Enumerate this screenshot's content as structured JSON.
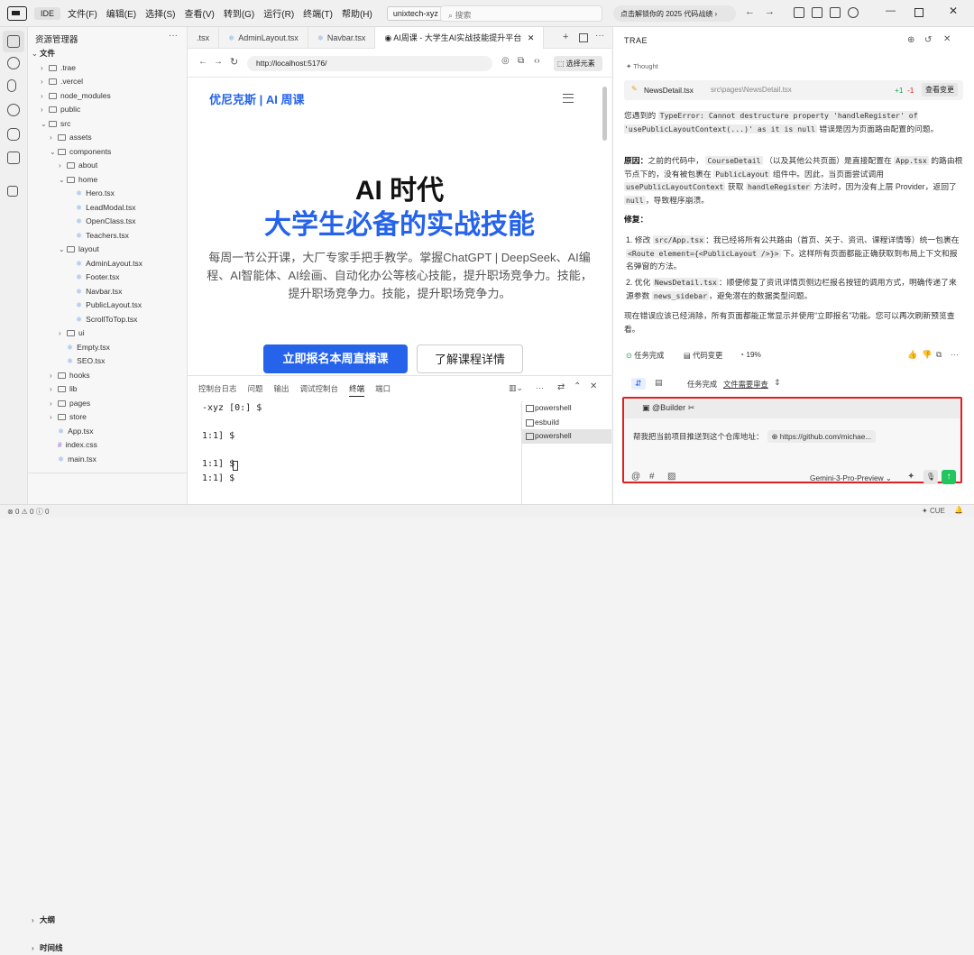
{
  "titlebar": {
    "ide": "IDE",
    "menus": [
      "文件(F)",
      "编辑(E)",
      "选择(S)",
      "查看(V)",
      "转到(G)",
      "运行(R)",
      "终端(T)",
      "帮助(H)"
    ],
    "workspace": "unixtech-xyz",
    "search_placeholder": "搜索",
    "promo": "点击解锁你的 2025 代码战绩"
  },
  "explorer": {
    "title": "资源管理器",
    "section": "文件",
    "outline": "大纲",
    "timeline": "时间线",
    "tree": [
      {
        "depth": 1,
        "kind": "dir",
        "open": false,
        "label": ".trae"
      },
      {
        "depth": 1,
        "kind": "dir",
        "open": false,
        "label": ".vercel"
      },
      {
        "depth": 1,
        "kind": "dir",
        "open": false,
        "label": "node_modules"
      },
      {
        "depth": 1,
        "kind": "dir",
        "open": false,
        "label": "public"
      },
      {
        "depth": 1,
        "kind": "dir",
        "open": true,
        "label": "src"
      },
      {
        "depth": 2,
        "kind": "dir",
        "open": false,
        "label": "assets"
      },
      {
        "depth": 2,
        "kind": "dir",
        "open": true,
        "label": "components"
      },
      {
        "depth": 3,
        "kind": "dir",
        "open": false,
        "label": "about"
      },
      {
        "depth": 3,
        "kind": "dir",
        "open": true,
        "label": "home"
      },
      {
        "depth": 4,
        "kind": "tsx",
        "label": "Hero.tsx"
      },
      {
        "depth": 4,
        "kind": "tsx",
        "label": "LeadModal.tsx"
      },
      {
        "depth": 4,
        "kind": "tsx",
        "label": "OpenClass.tsx"
      },
      {
        "depth": 4,
        "kind": "tsx",
        "label": "Teachers.tsx"
      },
      {
        "depth": 3,
        "kind": "dir",
        "open": true,
        "label": "layout"
      },
      {
        "depth": 4,
        "kind": "tsx",
        "label": "AdminLayout.tsx"
      },
      {
        "depth": 4,
        "kind": "tsx",
        "label": "Footer.tsx"
      },
      {
        "depth": 4,
        "kind": "tsx",
        "label": "Navbar.tsx"
      },
      {
        "depth": 4,
        "kind": "tsx",
        "label": "PublicLayout.tsx"
      },
      {
        "depth": 4,
        "kind": "tsx",
        "label": "ScrollToTop.tsx"
      },
      {
        "depth": 3,
        "kind": "dir",
        "open": false,
        "label": "ui"
      },
      {
        "depth": 3,
        "kind": "tsx",
        "label": "Empty.tsx"
      },
      {
        "depth": 3,
        "kind": "tsx",
        "label": "SEO.tsx"
      },
      {
        "depth": 2,
        "kind": "dir",
        "open": false,
        "label": "hooks"
      },
      {
        "depth": 2,
        "kind": "dir",
        "open": false,
        "label": "lib"
      },
      {
        "depth": 2,
        "kind": "dir",
        "open": false,
        "label": "pages"
      },
      {
        "depth": 2,
        "kind": "dir",
        "open": false,
        "label": "store"
      },
      {
        "depth": 2,
        "kind": "tsx",
        "label": "App.tsx"
      },
      {
        "depth": 2,
        "kind": "css",
        "label": "index.css"
      },
      {
        "depth": 2,
        "kind": "tsx",
        "label": "main.tsx"
      }
    ]
  },
  "tabs": [
    ".tsx",
    "AdminLayout.tsx",
    "Navbar.tsx",
    "AI周课 - 大学生AI实战技能提升平台"
  ],
  "browser": {
    "url": "http://localhost:5176/",
    "pick": "选择元素",
    "brand": "优尼克斯 | AI 周课",
    "hero_line1": "AI 时代",
    "hero_line2": "大学生必备的实战技能",
    "subtitle": "每周一节公开课，大厂专家手把手教学。掌握ChatGPT | DeepSeek、AI编程、AI智能体、AI绘画、自动化办公等核心技能，提升职场竞争力。技能，提升职场竞争力。技能，提升职场竞争力。",
    "cta_primary": "立即报名本周直播课",
    "cta_secondary": "了解课程详情"
  },
  "terminal": {
    "tabs": [
      "控制台日志",
      "问题",
      "输出",
      "调试控制台",
      "终端",
      "端口"
    ],
    "active": "终端",
    "lines": [
      "-xyz [0:] $",
      "",
      "1:1] $",
      "",
      "1:1] $",
      "1:1] $"
    ],
    "shells": [
      "powershell",
      "esbuild",
      "powershell"
    ]
  },
  "ai": {
    "title": "TRAE",
    "thought": "Thought",
    "file": "NewsDetail.tsx",
    "file_path": "src\\pages\\NewsDetail.tsx",
    "added": "+1",
    "removed": "-1",
    "view": "查看变更",
    "p1_pre": "您遇到的",
    "p1_code1": "TypeError: Cannot destructure property 'handleRegister' of 'usePublicLayoutContext(...)' as it is null",
    "p1_post": "错误是因为页面路由配置的问题。",
    "cause_label": "原因：",
    "cause_a": "之前的代码中，",
    "cause_code1": "CourseDetail",
    "cause_b": "（以及其他公共页面）是直接配置在",
    "cause_code2": "App.tsx",
    "cause_c": "的路由根节点下的，没有被包裹在",
    "cause_code3": "PublicLayout",
    "cause_d": "组件中。因此，当页面尝试调用",
    "cause_code4": "usePublicLayoutContext",
    "cause_e": "获取",
    "cause_code5": "handleRegister",
    "cause_f": "方法时，因为没有上层 Provider，返回了",
    "cause_code6": "null",
    "cause_g": "，导致程序崩溃。",
    "fix_label": "修复：",
    "fix1_a": "修改",
    "fix1_code1": "src/App.tsx",
    "fix1_b": "：我已经将所有公共路由（首页、关于、资讯、课程详情等）统一包裹在",
    "fix1_code2": "<Route element={<PublicLayout />}>",
    "fix1_c": "下。这样所有页面都能正确获取到布局上下文和报名弹窗的方法。",
    "fix2_a": "优化",
    "fix2_code1": "NewsDetail.tsx",
    "fix2_b": "：顺便修复了资讯详情页侧边栏报名按钮的调用方式，明确传递了来源参数",
    "fix2_code2": "news_sidebar",
    "fix2_c": "，避免潜在的数据类型问题。",
    "p3": "现在错误应该已经消除，所有页面都能正常显示并使用“立即报名”功能。您可以再次刷新预览查看。",
    "stat_done": "任务完成",
    "stat_changes": "代码变更",
    "stat_pct": "19%",
    "tab_done": "任务完成",
    "tab_review": "文件需要审查",
    "builder": "@Builder",
    "message": "帮我把当前项目推送到这个仓库地址：",
    "link_chip": "https://github.com/michae...",
    "model": "Gemini-3-Pro-Preview"
  },
  "status": {
    "errors": "0",
    "warnings": "0",
    "infos": "0",
    "cue": "CUE"
  },
  "colors": {
    "accent": "#2563eb",
    "highlight": "#e02020",
    "send": "#22c55e"
  }
}
